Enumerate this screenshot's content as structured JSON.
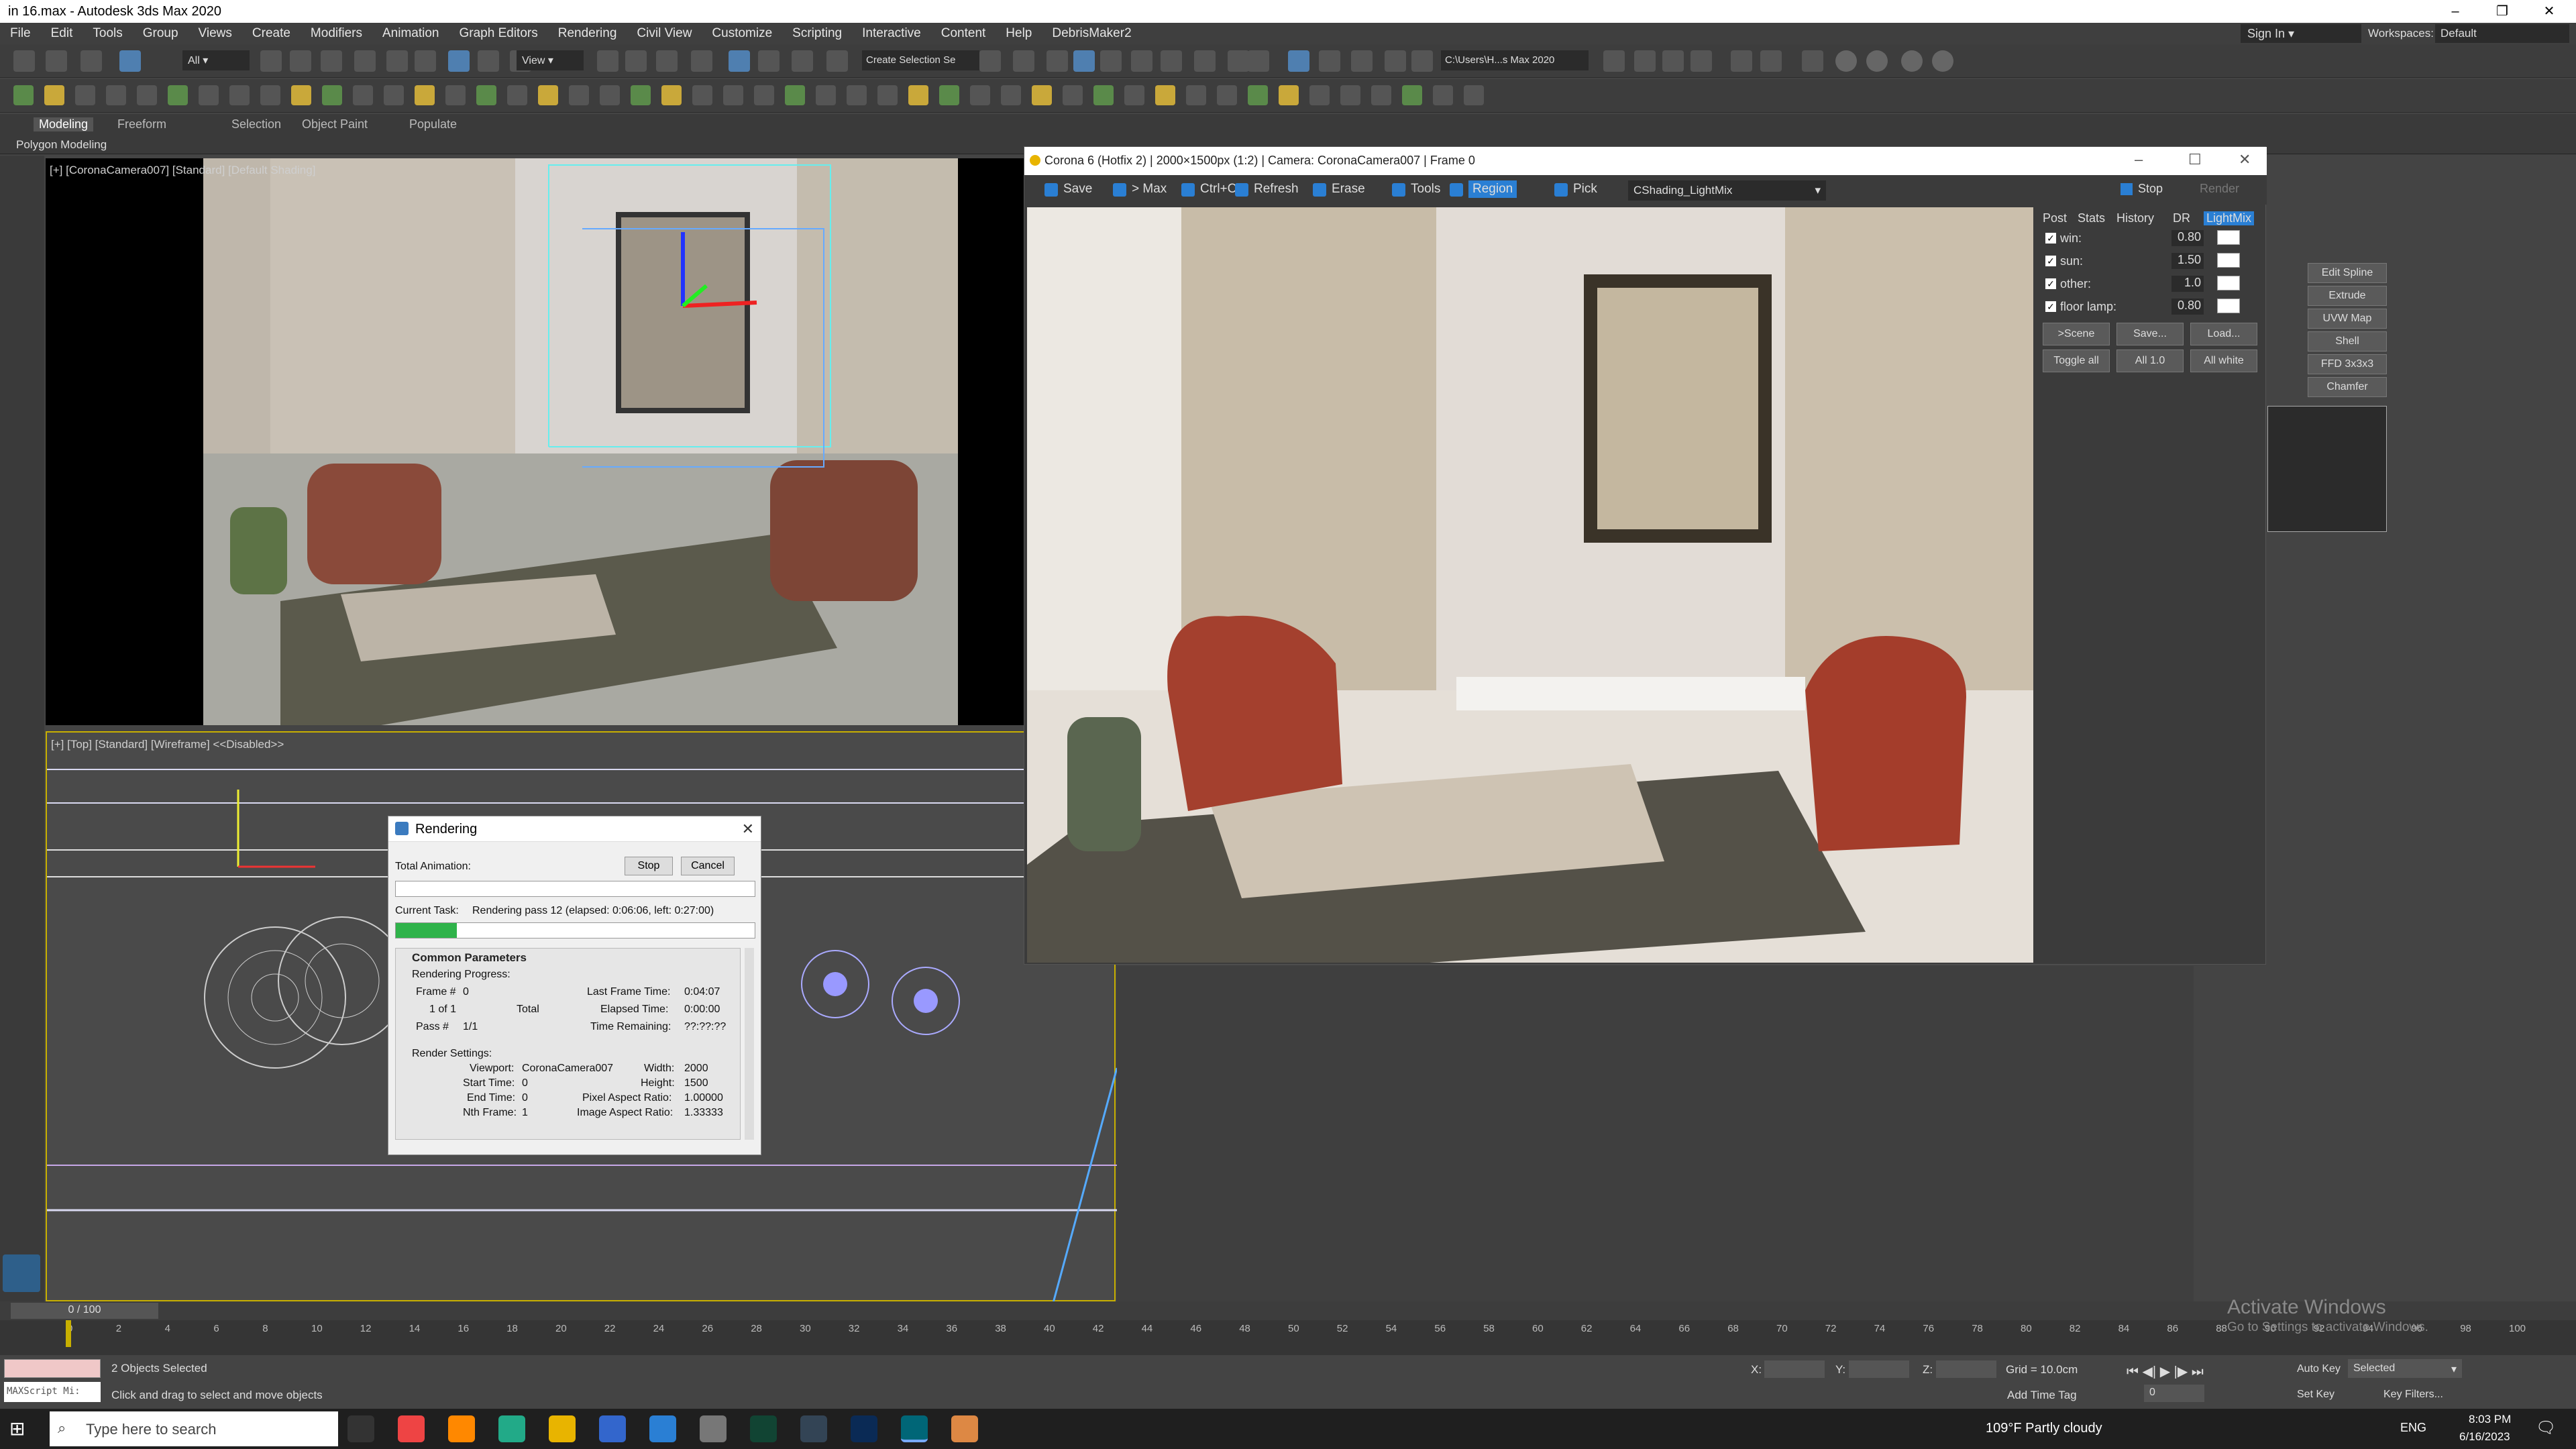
{
  "window": {
    "title": "in 16.max - Autodesk 3ds Max 2020"
  },
  "menu": [
    "File",
    "Edit",
    "Tools",
    "Group",
    "Views",
    "Create",
    "Modifiers",
    "Animation",
    "Graph Editors",
    "Rendering",
    "Civil View",
    "Customize",
    "Scripting",
    "Interactive",
    "Content",
    "Help",
    "DebrisMaker2"
  ],
  "account": {
    "sign_in": "Sign In",
    "workspaces_label": "Workspaces:",
    "workspace": "Default"
  },
  "toolbar": {
    "selection_filter": "All",
    "ref_coord": "View",
    "selection_set": "Create Selection Se",
    "path": "C:\\Users\\H...s Max 2020"
  },
  "ribbon": {
    "tabs": [
      "Modeling",
      "Freeform",
      "Selection",
      "Object Paint",
      "Populate"
    ],
    "sub": "Polygon Modeling"
  },
  "viewports": {
    "camera_label": "[+] [CoronaCamera007] [Standard] [Default Shading]",
    "top_label": "[+] [Top] [Standard] [Wireframe]  <<Disabled>>"
  },
  "rendering_dialog": {
    "title": "Rendering",
    "total_animation": "Total Animation:",
    "stop": "Stop",
    "cancel": "Cancel",
    "current_task_label": "Current Task:",
    "current_task": "Rendering pass 12 (elapsed: 0:06:06, left: 0:27:00)",
    "progress": 0.17,
    "section": "Common Parameters",
    "rendering_progress": "Rendering Progress:",
    "frame_label": "Frame #",
    "frame": "0",
    "of": "1 of 1",
    "total": "Total",
    "pass_label": "Pass #",
    "pass": "1/1",
    "last_frame_time_label": "Last Frame Time:",
    "last_frame_time": "0:04:07",
    "elapsed_label": "Elapsed Time:",
    "elapsed": "0:00:00",
    "remaining_label": "Time Remaining:",
    "remaining": "??:??:??",
    "render_settings": "Render Settings:",
    "viewport_label": "Viewport:",
    "viewport": "CoronaCamera007",
    "width_label": "Width:",
    "width": "2000",
    "start_time_label": "Start Time:",
    "start_time": "0",
    "height_label": "Height:",
    "height": "1500",
    "end_time_label": "End Time:",
    "end_time": "0",
    "pixel_aspect_label": "Pixel Aspect Ratio:",
    "pixel_aspect": "1.00000",
    "nth_frame_label": "Nth Frame:",
    "nth_frame": "1",
    "image_aspect_label": "Image Aspect Ratio:",
    "image_aspect": "1.33333"
  },
  "corona": {
    "title": "Corona 6 (Hotfix 2) | 2000×1500px (1:2) | Camera: CoronaCamera007 | Frame 0",
    "toolbar": [
      "Save",
      "> Max",
      "Ctrl+C",
      "Refresh",
      "Erase",
      "Tools",
      "Region",
      "Pick"
    ],
    "channel": "CShading_LightMix",
    "stop": "Stop",
    "render": "Render",
    "tabs": [
      "Post",
      "Stats",
      "History",
      "DR",
      "LightMix"
    ],
    "lightmix": [
      {
        "name": "win:",
        "value": "0.80"
      },
      {
        "name": "sun:",
        "value": "1.50"
      },
      {
        "name": "other:",
        "value": "1.0"
      },
      {
        "name": "floor lamp:",
        "value": "0.80"
      }
    ],
    "buttons1": [
      ">Scene",
      "Save...",
      "Load..."
    ],
    "buttons2": [
      "Toggle all",
      "All 1.0",
      "All white"
    ]
  },
  "command_panel": {
    "buttons": [
      "Edit Spline",
      "Extrude",
      "UVW Map",
      "Shell",
      "FFD 3x3x3",
      "Chamfer"
    ]
  },
  "timeline": {
    "frame_counter": "0 / 100",
    "ticks": [
      "0",
      "2",
      "4",
      "6",
      "8",
      "10",
      "12",
      "14",
      "16",
      "18",
      "20",
      "22",
      "24",
      "26",
      "28",
      "30",
      "32",
      "34",
      "36",
      "38",
      "40",
      "42",
      "44",
      "46",
      "48",
      "50",
      "52",
      "54",
      "56",
      "58",
      "60",
      "62",
      "64",
      "66",
      "68",
      "70",
      "72",
      "74",
      "76",
      "78",
      "80",
      "82",
      "84",
      "86",
      "88",
      "90",
      "92",
      "94",
      "96",
      "98",
      "100"
    ]
  },
  "status": {
    "script": "MAXScript Mi:",
    "selected": "2 Objects Selected",
    "hint": "Click and drag to select and move objects",
    "x": "X:",
    "y": "Y:",
    "z": "Z:",
    "grid": "Grid = 10.0cm",
    "add_time_tag": "Add Time Tag",
    "auto_key": "Auto Key",
    "set_key": "Set Key",
    "selected_dropdown": "Selected",
    "key_filters": "Key Filters...",
    "frame": "0"
  },
  "activate": {
    "title": "Activate Windows",
    "sub": "Go to Settings to activate Windows."
  },
  "taskbar": {
    "search": "Type here to search",
    "weather": "109°F  Partly cloudy",
    "lang": "ENG",
    "time": "8:03 PM",
    "date": "6/16/2023"
  }
}
